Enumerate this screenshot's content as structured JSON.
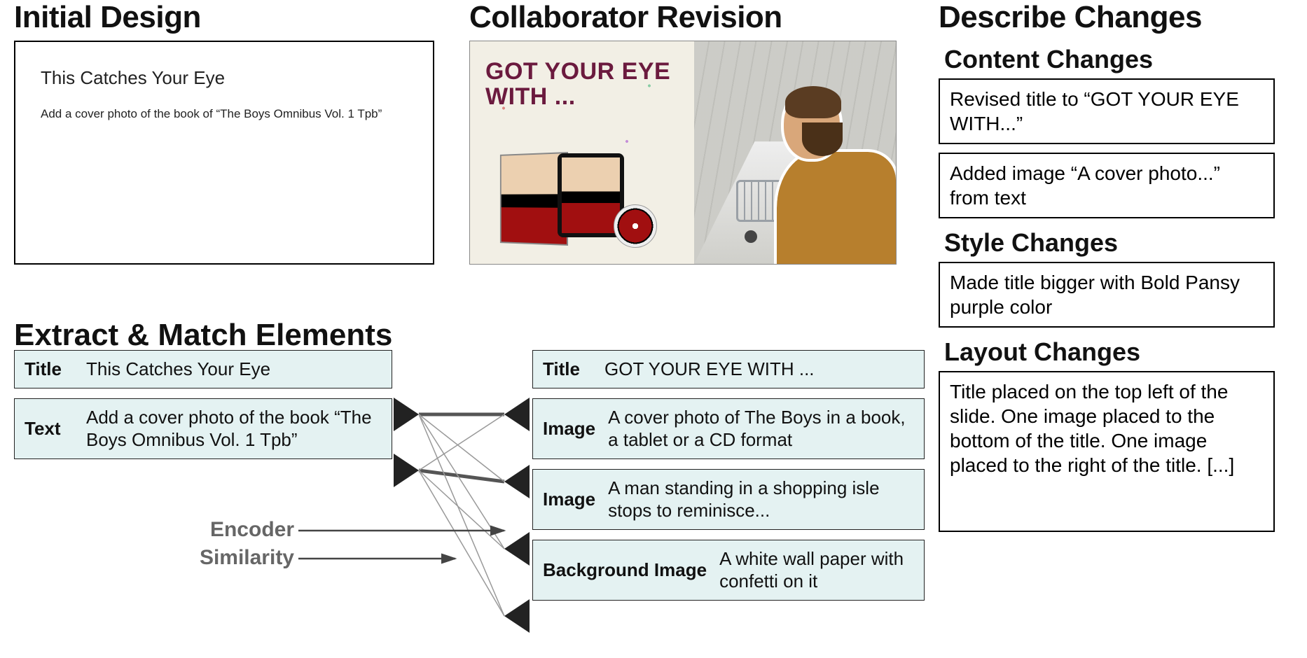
{
  "headings": {
    "initial": "Initial Design",
    "collab": "Collaborator Revision",
    "describe": "Describe Changes",
    "extract": "Extract & Match Elements",
    "content": "Content Changes",
    "style": "Style Changes",
    "layout": "Layout Changes"
  },
  "initial_design": {
    "title": "This Catches Your Eye",
    "text": "Add a cover photo of the book of “The Boys Omnibus Vol. 1 Tpb”"
  },
  "collab_revision": {
    "title": "GOT YOUR EYE WITH ..."
  },
  "left_elements": [
    {
      "label": "Title",
      "value": "This Catches Your Eye"
    },
    {
      "label": "Text",
      "value": "Add a cover photo of the book “The Boys Omnibus Vol. 1 Tpb”"
    }
  ],
  "right_elements": [
    {
      "label": "Title",
      "value": "GOT YOUR EYE WITH ..."
    },
    {
      "label": "Image",
      "value": "A cover photo of The Boys in a book, a tablet or a CD format"
    },
    {
      "label": "Image",
      "value": "A man standing in a shopping isle stops to reminisce..."
    },
    {
      "label": "Background Image",
      "value": "A white wall paper with confetti on it"
    }
  ],
  "encoder_label_1": "Encoder",
  "encoder_label_2": "Similarity",
  "changes": {
    "content": [
      "Revised title to “GOT YOUR EYE WITH...”",
      "Added image  “A cover photo...” from text"
    ],
    "style": [
      "Made title bigger with Bold Pansy purple color"
    ],
    "layout": [
      "Title placed on the top left of the slide. One image placed to the bottom of the title. One image placed to the right of the title. [...]"
    ]
  }
}
